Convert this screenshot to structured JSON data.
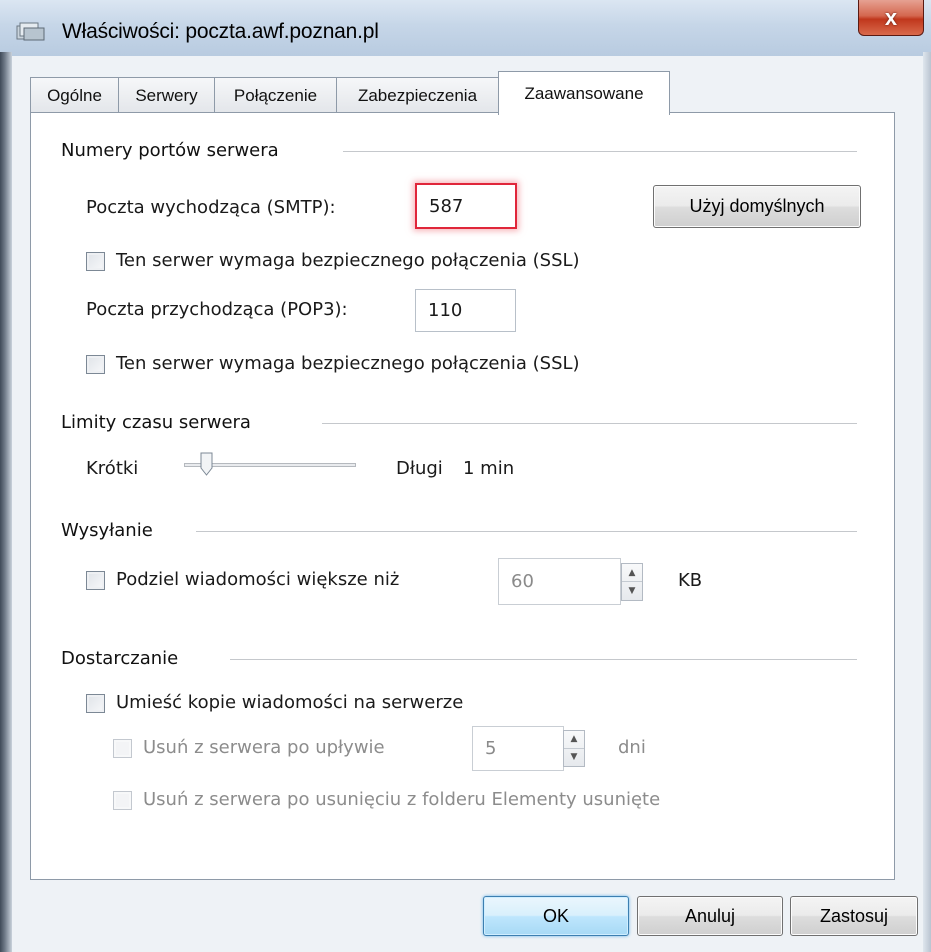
{
  "window": {
    "title": "Właściwości: poczta.awf.poznan.pl",
    "close_label": "x"
  },
  "tabs": [
    {
      "label": "Ogólne"
    },
    {
      "label": "Serwery"
    },
    {
      "label": "Połączenie"
    },
    {
      "label": "Zabezpieczenia"
    },
    {
      "label": "Zaawansowane",
      "active": true
    }
  ],
  "ports": {
    "section_label": "Numery portów serwera",
    "smtp_label": "Poczta wychodząca (SMTP):",
    "smtp_value": "587",
    "default_button": "Użyj domyślnych",
    "smtp_ssl_label": "Ten serwer wymaga bezpiecznego połączenia (SSL)",
    "smtp_ssl_checked": false,
    "pop3_label": "Poczta przychodząca (POP3):",
    "pop3_value": "110",
    "pop3_ssl_label": "Ten serwer wymaga bezpiecznego połączenia (SSL)",
    "pop3_ssl_checked": false
  },
  "timeouts": {
    "section_label": "Limity czasu serwera",
    "short_label": "Krótki",
    "long_label": "Długi",
    "value_label": "1 min",
    "slider_position": 0.1
  },
  "sending": {
    "section_label": "Wysyłanie",
    "split_label": "Podziel wiadomości większe niż",
    "split_checked": false,
    "split_value": "60",
    "split_unit": "KB"
  },
  "delivery": {
    "section_label": "Dostarczanie",
    "leave_copy_label": "Umieść kopie wiadomości na serwerze",
    "leave_copy_checked": false,
    "remove_after_label": "Usuń z serwera po upływie",
    "remove_after_value": "5",
    "remove_after_unit": "dni",
    "remove_deleted_label": "Usuń z serwera po usunięciu z folderu Elementy usunięte"
  },
  "buttons": {
    "ok": "OK",
    "cancel": "Anuluj",
    "apply": "Zastosuj"
  },
  "colors": {
    "focus_border": "#e0263a",
    "default_button": "#a7d9f5",
    "close_button": "#c0371c"
  },
  "icons": [
    "window-app-icon",
    "close-icon",
    "spin-up-icon",
    "spin-down-icon",
    "slider-thumb-icon"
  ]
}
